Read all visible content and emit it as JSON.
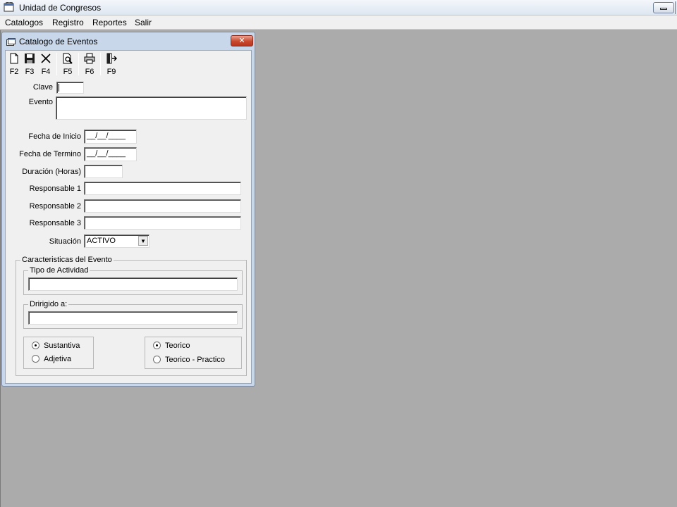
{
  "app": {
    "title": "Unidad de Congresos",
    "icon": "window-icon"
  },
  "menu": {
    "items": [
      "Catalogos",
      "Registro",
      "Reportes",
      "Salir"
    ]
  },
  "child": {
    "title": "Catalogo de Eventos",
    "close_label": "✕"
  },
  "toolbar": {
    "buttons": [
      {
        "key": "F2",
        "icon": "new-document-icon"
      },
      {
        "key": "F3",
        "icon": "save-icon"
      },
      {
        "key": "F4",
        "icon": "delete-x-icon"
      },
      {
        "key": "F5",
        "icon": "preview-search-icon"
      },
      {
        "key": "F6",
        "icon": "print-icon"
      },
      {
        "key": "F9",
        "icon": "exit-door-icon"
      }
    ]
  },
  "form": {
    "clave_label": "Clave",
    "clave_value": "",
    "evento_label": "Evento",
    "evento_value": "",
    "fecha_inicio_label": "Fecha de Inicio",
    "fecha_inicio_value": "__/__/____",
    "fecha_termino_label": "Fecha de Termino",
    "fecha_termino_value": "__/__/____",
    "duracion_label": "Duración (Horas)",
    "duracion_value": "",
    "responsable1_label": "Responsable 1",
    "responsable1_value": "",
    "responsable2_label": "Responsable 2",
    "responsable2_value": "",
    "responsable3_label": "Responsable 3",
    "responsable3_value": "",
    "situacion_label": "Situación",
    "situacion_value": "ACTIVO"
  },
  "caracteristicas": {
    "title": "Caracteristicas del Evento",
    "tipo_actividad_label": "Tipo de Actividad",
    "tipo_actividad_value": "",
    "dirigido_label": "Dririgido a:",
    "dirigido_value": "",
    "group1": {
      "options": [
        "Sustantiva",
        "Adjetiva"
      ],
      "selected": "Sustantiva"
    },
    "group2": {
      "options": [
        "Teorico",
        "Teorico - Practico"
      ],
      "selected": "Teorico"
    }
  },
  "colors": {
    "workspace": "#ababab",
    "window_frame": "#c8d7ea",
    "close_button": "#c8482f",
    "field_border": "#7f9db9"
  }
}
